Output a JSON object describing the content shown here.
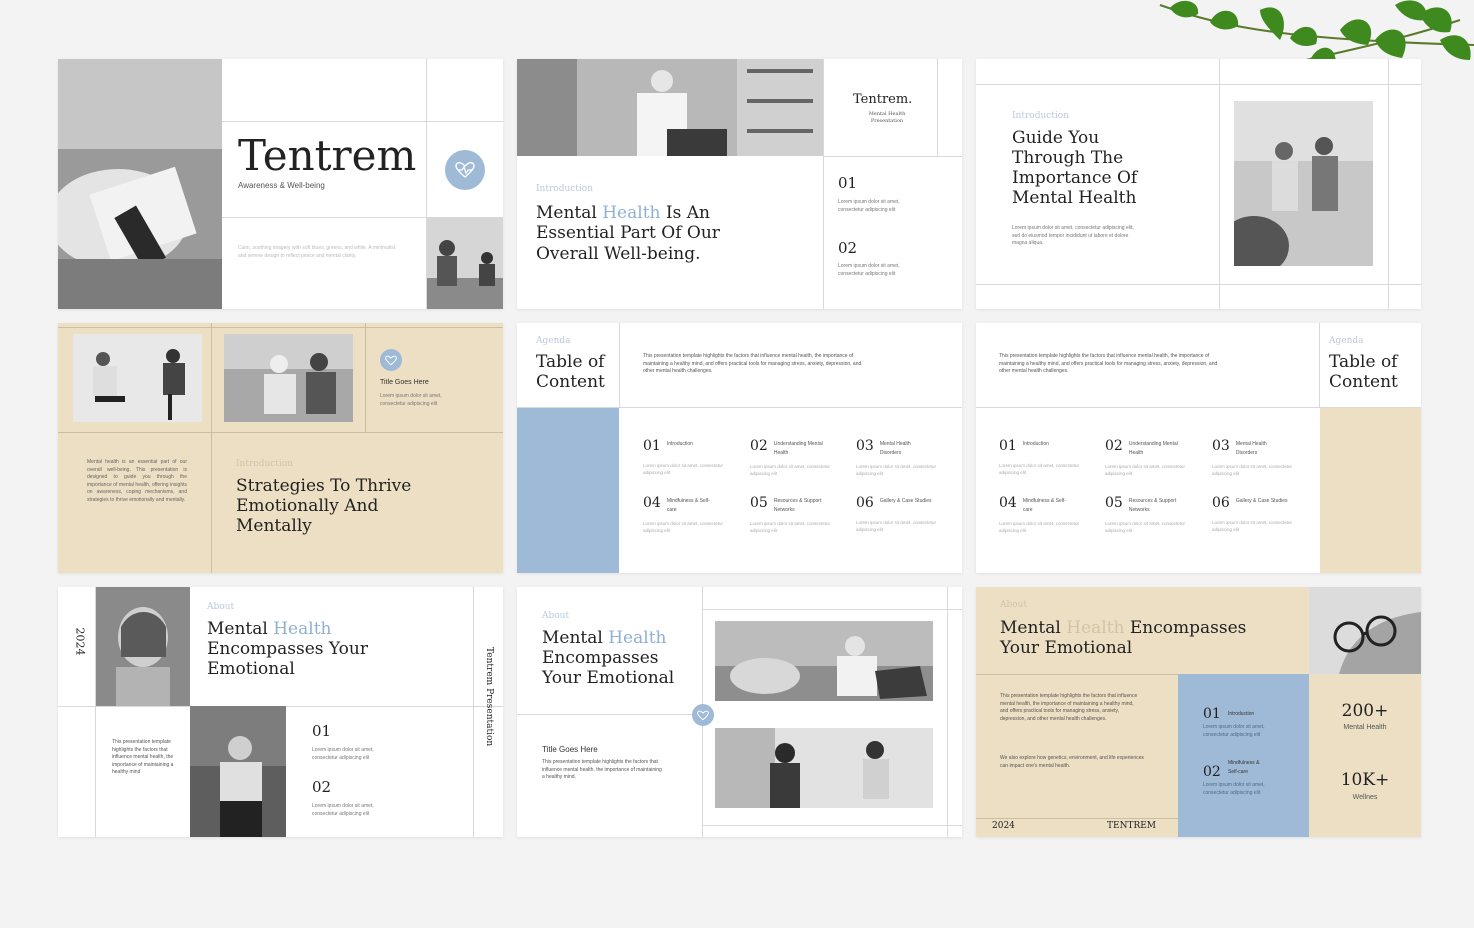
{
  "s1": {
    "title": "Tentrem",
    "subtitle": "Awareness & Well-being",
    "desc": "Calm, soothing imagery with soft blues, greens, and white. A minimalist and serene design to reflect peace and mental clarity."
  },
  "s2": {
    "brand": "Tentrem.",
    "brand_sub": "Mental Health Presentation",
    "label": "Introduction",
    "h_pre": "Mental",
    "h_hl": "Health",
    "h_post": "Is An Essential Part Of Our Overall Well-being.",
    "n1": "01",
    "n2": "02",
    "lorem": "Lorem ipsum dolor sit amet, consectetur adipiscing elit"
  },
  "s3": {
    "label": "Introduction",
    "heading": "Guide You Through The Importance Of Mental Health",
    "body": "Lorem ipsum dolor sit amet, consectetur adipiscing elit, sed do eiusmod tempor incididunt ut labore et dolore magna aliqua."
  },
  "s4": {
    "title": "Title Goes Here",
    "desc": "Lorem ipsum dolor sit amet, consectetur adipiscing elit",
    "body": "Mental health is an essential part of our overall well-being. This presentation is designed to guide you through the importance of mental health, offering insights on awareness, coping mechanisms, and strategies to thrive emotionally and mentally.",
    "label": "Introduction",
    "heading": "Strategies To Thrive Emotionally And Mentally"
  },
  "toc": {
    "label": "Agenda",
    "heading": "Table of Content",
    "intro": "This presentation template highlights the factors that influence mental health, the importance of maintaining a healthy mind, and offers practical tools for managing stress, anxiety, depression, and other mental health challenges.",
    "desc": "Lorem ipsum dolor sit amet, consectetur adipiscing elit",
    "items": [
      {
        "n": "01",
        "t": "Introduction"
      },
      {
        "n": "02",
        "t": "Understanding Mental Health"
      },
      {
        "n": "03",
        "t": "Mental Health Disorders"
      },
      {
        "n": "04",
        "t": "Mindfulness & Self-care"
      },
      {
        "n": "05",
        "t": "Resources & Support Networks"
      },
      {
        "n": "06",
        "t": "Gallery & Case Studies"
      }
    ]
  },
  "s7": {
    "year": "2024",
    "label": "About",
    "h_pre": "Mental",
    "h_hl": "Health",
    "h_post": "Encompasses Your Emotional",
    "side": "Tentrem Presentation",
    "body": "This presentation template highlights the factors that influence mental health, the importance of maintaining a healthy mind",
    "n1": "01",
    "n2": "02",
    "lorem": "Lorem ipsum dolor sit amet, consectetur adipiscing elit"
  },
  "s8": {
    "label": "About",
    "h_pre": "Mental",
    "h_hl": "Health",
    "h_post": "Encompasses Your Emotional",
    "title": "Title Goes Here",
    "body": "This presentation template highlights the factors that influence mental health, the importance of maintaining a healthy mind."
  },
  "s9": {
    "label": "About",
    "h_pre": "Mental",
    "h_hl": "Health",
    "h_post": "Encompasses Your Emotional",
    "body1": "This presentation template highlights the factors that influence mental health, the importance of maintaining a healthy mind, and offers practical tools for managing stress, anxiety, depression, and other mental health challenges.",
    "body2": "We also explore how genetics, environment, and life experiences can impact one's mental health.",
    "year": "2024",
    "brand": "TENTREM",
    "i1_n": "01",
    "i1_t": "Introduction",
    "i2_n": "02",
    "i2_t": "Self-care",
    "i2_t0": "Mindfulness &",
    "lorem": "Lorem ipsum dolor sit amet, consectetur adipiscing elit",
    "stat1": "200+",
    "stat1_l": "Mental Health",
    "stat2": "10K+",
    "stat2_l": "Wellnes"
  },
  "colors": {
    "blue": "#9fbad7",
    "beige": "#ecdfc3",
    "accent_text": "#8fb0d3"
  }
}
